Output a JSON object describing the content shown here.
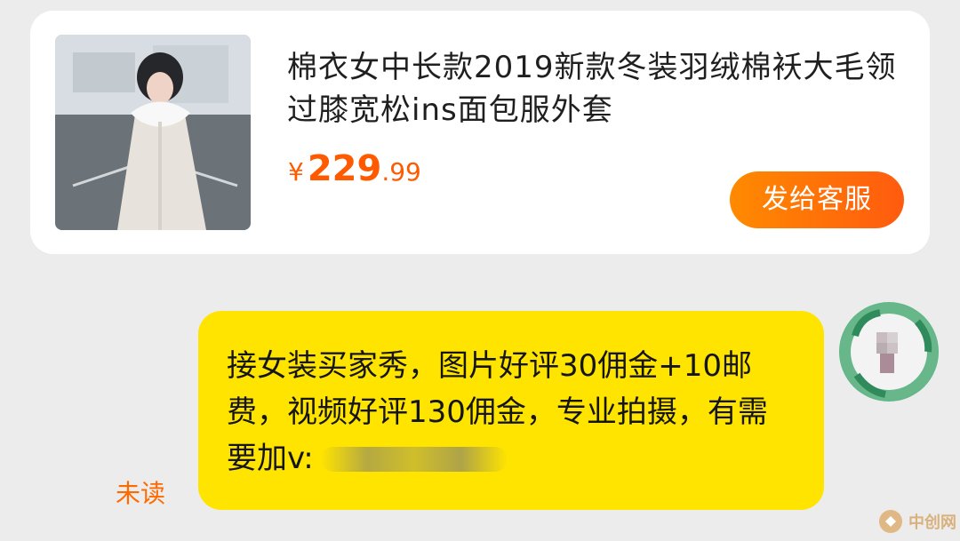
{
  "product_card": {
    "title": "棉衣女中长款2019新款冬装羽绒棉袄大毛领过膝宽松ins面包服外套",
    "price_currency": "¥",
    "price_integer": "229",
    "price_decimal": ".99",
    "send_button_label": "发给客服",
    "image_icon": "product-photo-icon"
  },
  "message": {
    "text": "接女装买家秀，图片好评30佣金+10邮费，视频好评130佣金，专业拍摄，有需要加v:",
    "status": "未读",
    "avatar_icon": "user-avatar-icon"
  },
  "watermark": {
    "text": "中创网",
    "logo_icon": "logo-icon"
  },
  "colors": {
    "background": "#ececec",
    "card_background": "#ffffff",
    "price": "#ff5a00",
    "button_start": "#ff8a00",
    "button_end": "#ff5b0f",
    "bubble": "#ffe400",
    "unread": "#ff6a00"
  }
}
